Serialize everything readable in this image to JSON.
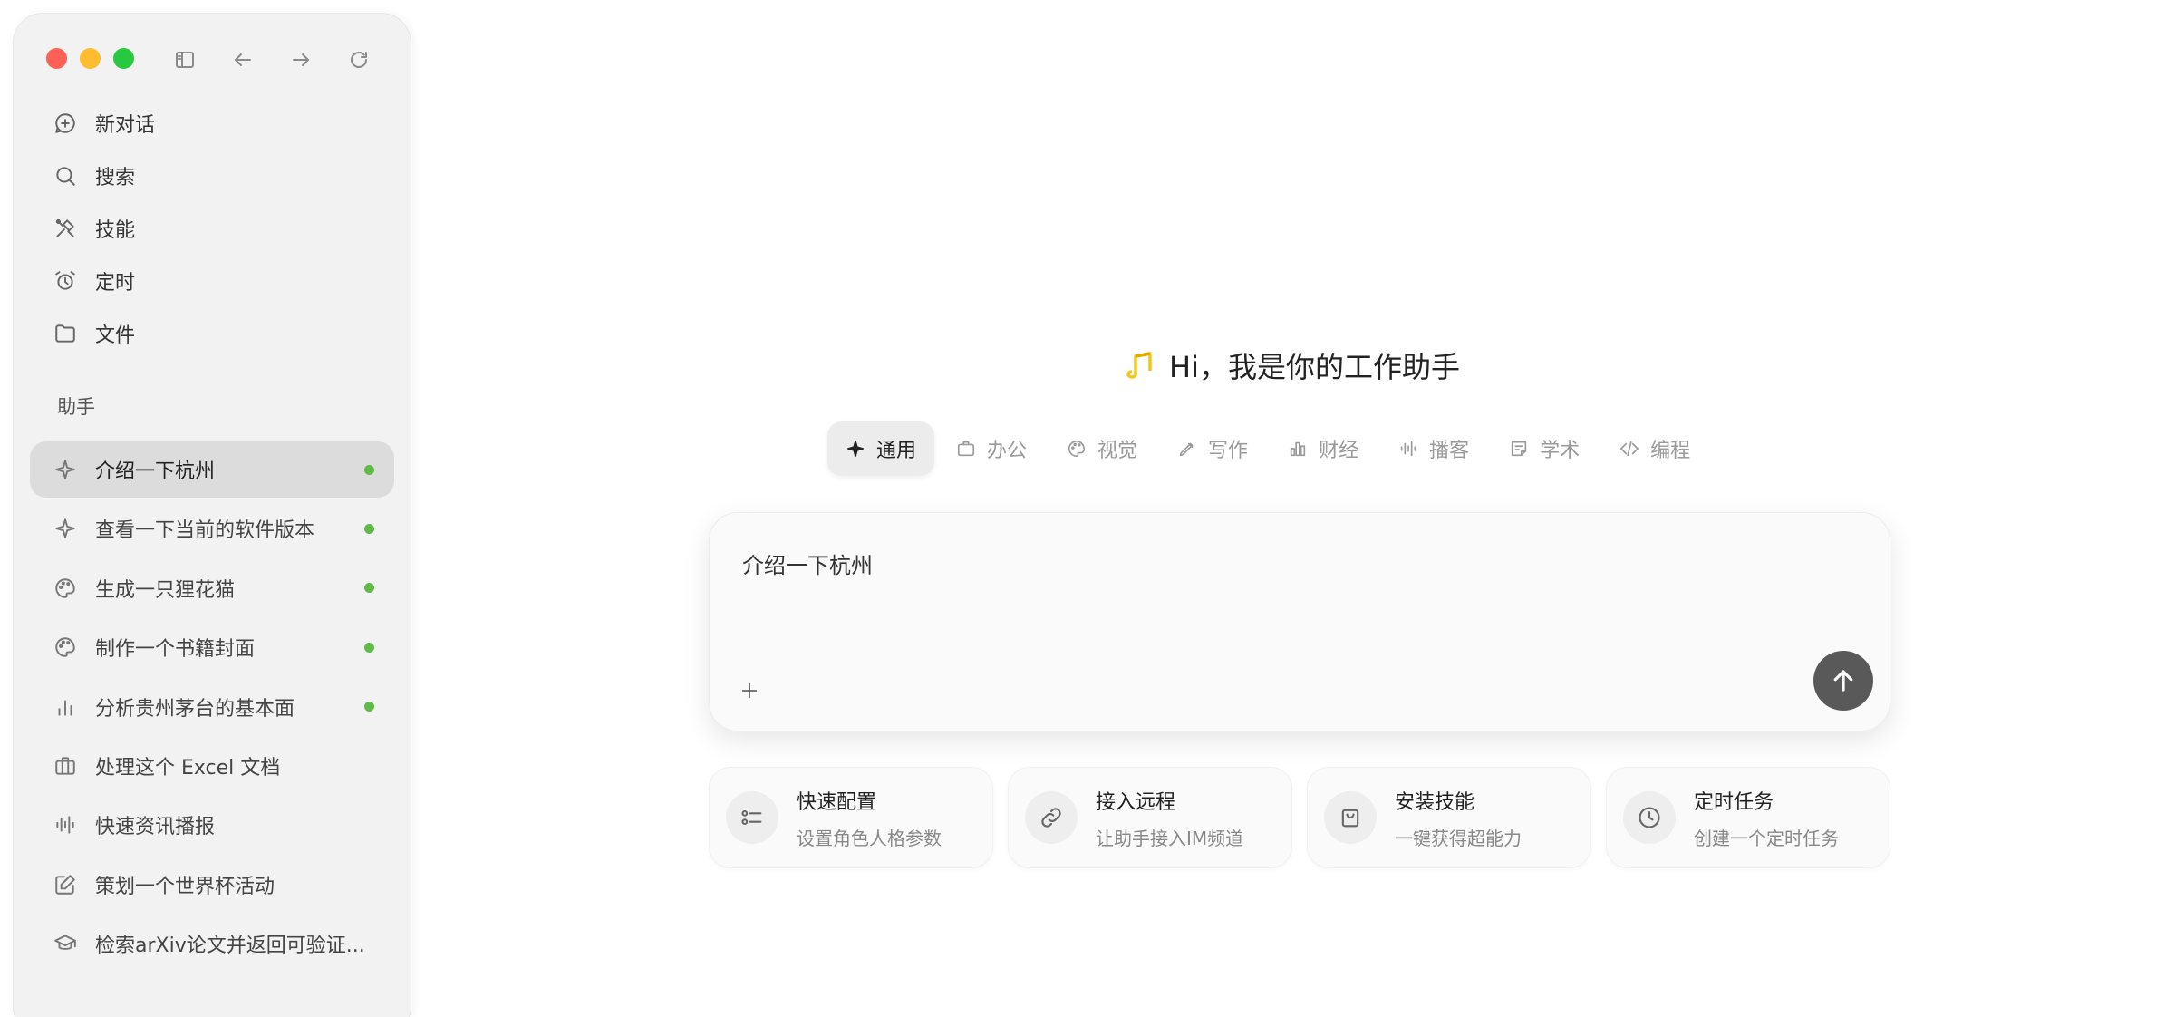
{
  "sidebar": {
    "nav": [
      {
        "label": "新对话",
        "icon": "new-chat-icon"
      },
      {
        "label": "搜索",
        "icon": "search-icon"
      },
      {
        "label": "技能",
        "icon": "skills-tools-icon"
      },
      {
        "label": "定时",
        "icon": "alarm-clock-icon"
      },
      {
        "label": "文件",
        "icon": "folder-icon"
      }
    ],
    "section_title": "助手",
    "assistants": [
      {
        "label": "介绍一下杭州",
        "icon": "sparkle-icon",
        "active": true,
        "status": "online"
      },
      {
        "label": "查看一下当前的软件版本",
        "icon": "sparkle-icon",
        "status": "online"
      },
      {
        "label": "生成一只狸花猫",
        "icon": "palette-icon",
        "status": "online"
      },
      {
        "label": "制作一个书籍封面",
        "icon": "palette-icon",
        "status": "online"
      },
      {
        "label": "分析贵州茅台的基本面",
        "icon": "bar-chart-icon",
        "status": "online"
      },
      {
        "label": "处理这个 Excel 文档",
        "icon": "briefcase-icon"
      },
      {
        "label": "快速资讯播报",
        "icon": "audio-wave-icon"
      },
      {
        "label": "策划一个世界杯活动",
        "icon": "edit-icon"
      },
      {
        "label": "检索arXiv论文并返回可验证...",
        "icon": "graduation-cap-icon"
      }
    ]
  },
  "main": {
    "greeting": "Hi，我是你的工作助手",
    "tabs": [
      {
        "label": "通用",
        "icon": "sparkle-icon",
        "active": true
      },
      {
        "label": "办公",
        "icon": "briefcase-icon"
      },
      {
        "label": "视觉",
        "icon": "palette-icon"
      },
      {
        "label": "写作",
        "icon": "pen-icon"
      },
      {
        "label": "财经",
        "icon": "bar-chart-icon"
      },
      {
        "label": "播客",
        "icon": "audio-wave-icon"
      },
      {
        "label": "学术",
        "icon": "note-icon"
      },
      {
        "label": "编程",
        "icon": "code-icon"
      }
    ],
    "composer": {
      "text": "介绍一下杭州"
    },
    "cards": [
      {
        "title": "快速配置",
        "subtitle": "设置角色人格参数",
        "icon": "settings-list-icon"
      },
      {
        "title": "接入远程",
        "subtitle": "让助手接入IM频道",
        "icon": "link-icon"
      },
      {
        "title": "安装技能",
        "subtitle": "一键获得超能力",
        "icon": "shopping-bag-icon"
      },
      {
        "title": "定时任务",
        "subtitle": "创建一个定时任务",
        "icon": "clock-icon"
      }
    ]
  },
  "colors": {
    "status_dot": "#5fba46",
    "send_button": "#595959",
    "logo_yellow": "#f5c518",
    "traffic_red": "#fe5f57",
    "traffic_yellow": "#febc2e",
    "traffic_green": "#28c840"
  }
}
